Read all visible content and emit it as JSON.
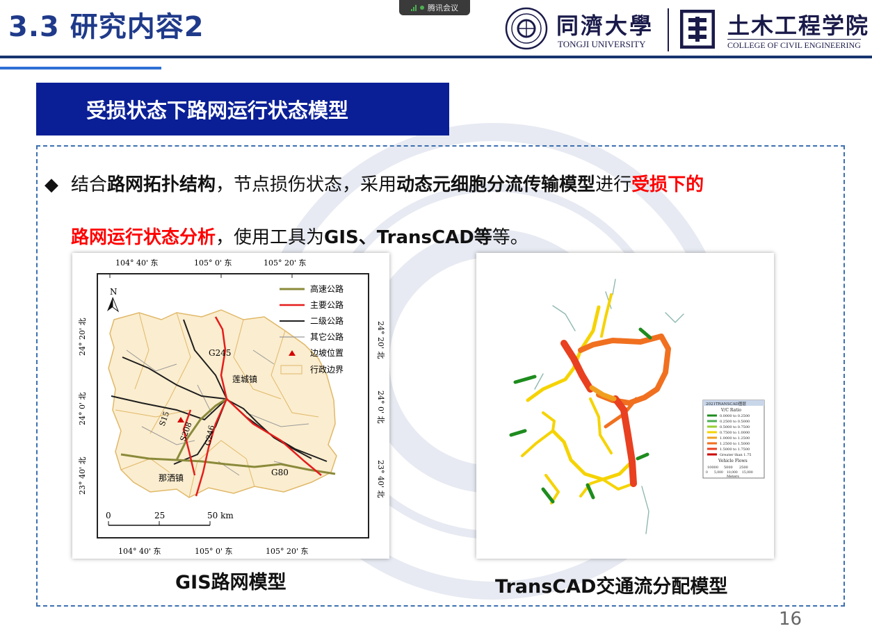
{
  "header": {
    "slide_title": "3.3 研究内容2",
    "meeting_app": "腾讯会议",
    "university_cn": "同濟大學",
    "university_en": "TONGJI UNIVERSITY",
    "college_cn": "土木工程学院",
    "college_en": "COLLEGE OF CIVIL ENGINEERING"
  },
  "section": {
    "title": "受损状态下路网运行状态模型"
  },
  "paragraph": {
    "bullet": "◆",
    "t1": "结合",
    "t2": "路网拓扑结构",
    "t3": "，节点损伤状态，采用",
    "t4": "动态元细胞分流传输模型",
    "t5": "进行",
    "t6": "受损下的",
    "t7": "路网运行状态分析",
    "t8": "，使用工具为",
    "t9": "GIS、TransCAD等",
    "t10": "等。"
  },
  "gis_map": {
    "top_ticks": [
      "104° 40' 东",
      "105° 0' 东",
      "105° 20' 东"
    ],
    "bottom_ticks": [
      "104° 40' 东",
      "105° 0' 东",
      "105° 20' 东"
    ],
    "left_ticks": [
      "24° 20' 北",
      "24° 0' 北",
      "23° 40' 北"
    ],
    "right_ticks": [
      "24° 20' 北",
      "24° 0' 北",
      "23° 40' 北"
    ],
    "north": "N",
    "legend": {
      "expressway": "高速公路",
      "major_road": "主要公路",
      "secondary_road": "二级公路",
      "other_road": "其它公路",
      "slope_location": "边坡位置",
      "admin_boundary": "行政边界"
    },
    "place_labels": {
      "g245": "G245",
      "liancheng": "莲城镇",
      "s15": "S15",
      "s208": "S208",
      "g246": "G246",
      "g80": "G80",
      "najiu": "那洒镇"
    },
    "scale": {
      "zero": "0",
      "mid": "25",
      "end": "50 km"
    },
    "colors": {
      "expressway": "#8a8a3a",
      "major_road": "#e51c1c",
      "secondary_road": "#1e1e1e",
      "other_road": "#9a9a9a",
      "slope": "#d40000",
      "boundary_fill": "#fbedcf",
      "boundary_stroke": "#e0b868"
    }
  },
  "transcad_map": {
    "legend_title": "2021TRANSCAD图层",
    "legend_vc": "V/C Ratio",
    "legend_items": [
      "0.0000 to 0.2500",
      "0.2500 to 0.5000",
      "0.5000 to 0.7500",
      "0.7500 to 1.0000",
      "1.0000 to 1.2500",
      "1.2500 to 1.5000",
      "1.5000 to 1.7500",
      "Greater than 1.75"
    ],
    "legend_colors": [
      "#1e8c1e",
      "#4caf50",
      "#9acd32",
      "#f5d300",
      "#f0a020",
      "#f07020",
      "#e84020",
      "#cc0000"
    ],
    "legend_flows": "Vehicle Flows",
    "flow_values": [
      "10000",
      "5000",
      "2500"
    ],
    "scale_values": [
      "0",
      "5,000",
      "10,000",
      "15,000"
    ],
    "scale_unit": "Meters"
  },
  "captions": {
    "gis": "GIS路网模型",
    "transcad": "TransCAD交通流分配模型"
  },
  "page_number": "16"
}
